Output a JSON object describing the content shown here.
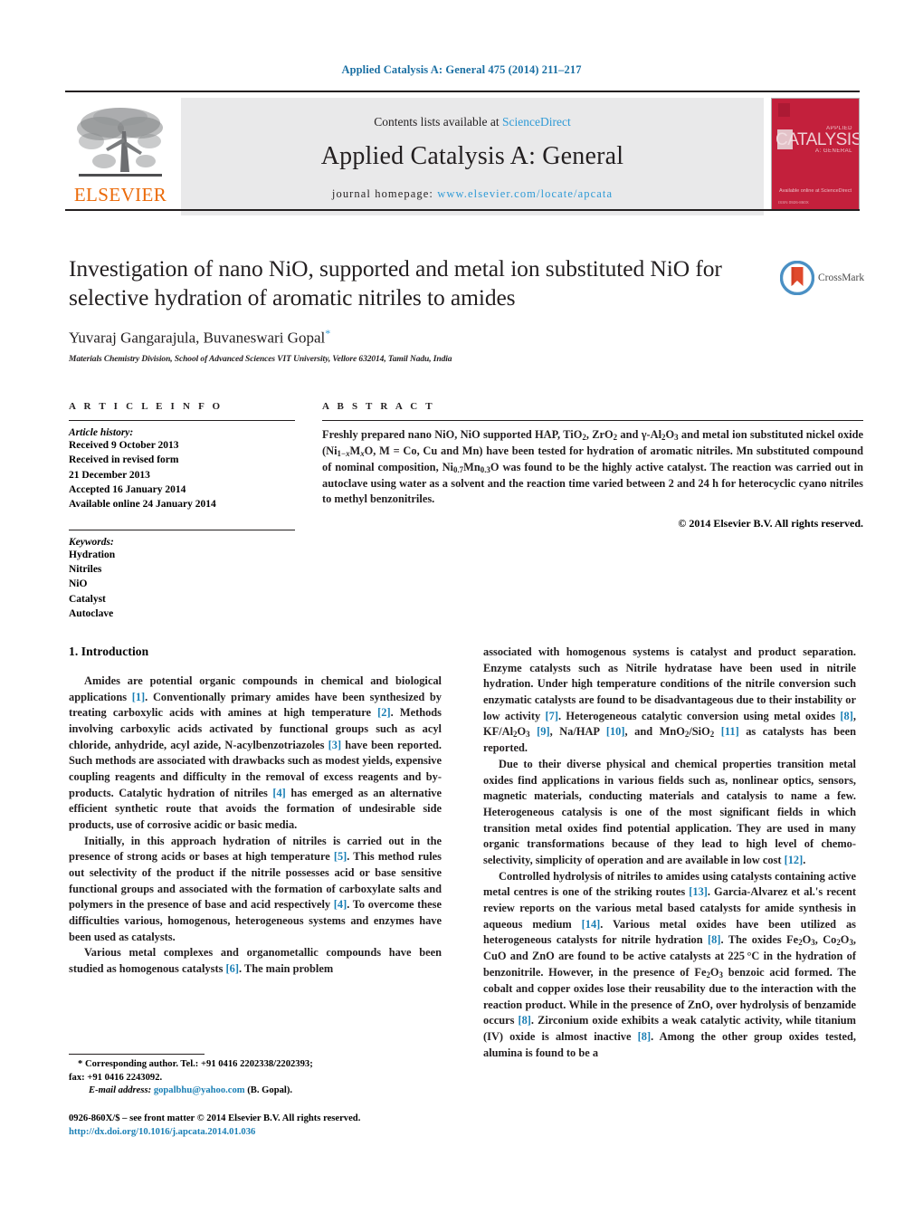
{
  "running_head": "Applied Catalysis A: General 475 (2014) 211–217",
  "masthead": {
    "publisher": "ELSEVIER",
    "contents_prefix": "Contents lists available at ",
    "contents_link": "ScienceDirect",
    "journal_name": "Applied Catalysis A: General",
    "homepage_prefix": "journal homepage: ",
    "homepage_url": "www.elsevier.com/locate/apcata",
    "cover": {
      "title": "CATALYSIS",
      "sub_top": "APPLIED",
      "sub_bottom": "A: GENERAL",
      "footer": "Available online at\nScienceDirect",
      "bottom_note": "ISSN 0926-860X"
    }
  },
  "article": {
    "title": "Investigation of nano NiO, supported and metal ion substituted NiO for selective hydration of aromatic nitriles to amides",
    "authors": "Yuvaraj Gangarajula, Buvaneswari Gopal",
    "corresponding_marker": "*",
    "affiliation": "Materials Chemistry Division, School of Advanced Sciences VIT University, Vellore 632014, Tamil Nadu, India",
    "crossmark_label": "CrossMark"
  },
  "article_info": {
    "heading": "A R T I C L E   I N F O",
    "history_label": "Article history:",
    "history": [
      "Received 9 October 2013",
      "Received in revised form",
      "21 December 2013",
      "Accepted 16 January 2014",
      "Available online 24 January 2014"
    ],
    "keywords_label": "Keywords:",
    "keywords": [
      "Hydration",
      "Nitriles",
      "NiO",
      "Catalyst",
      "Autoclave"
    ]
  },
  "abstract": {
    "heading": "A B S T R A C T",
    "copyright": "© 2014 Elsevier B.V. All rights reserved."
  },
  "sections": {
    "introduction_heading": "1.  Introduction"
  },
  "footnote": {
    "corresponding": "* Corresponding author. Tel.: +91 0416 2202338/2202393;",
    "fax": "fax: +91 0416 2243092.",
    "email_label": "E-mail address:",
    "email": "gopalbhu@yahoo.com",
    "email_suffix": "(B. Gopal)."
  },
  "imprint": {
    "issn_line": "0926-860X/$ – see front matter © 2014 Elsevier B.V. All rights reserved.",
    "doi": "http://dx.doi.org/10.1016/j.apcata.2014.01.036"
  },
  "colors": {
    "link": "#1a7fb5",
    "sciencedirect": "#2e9ad6",
    "elsevier_orange": "#eb6a09",
    "cover_red": "#c3203c",
    "band_gray": "#e9e9ea"
  }
}
